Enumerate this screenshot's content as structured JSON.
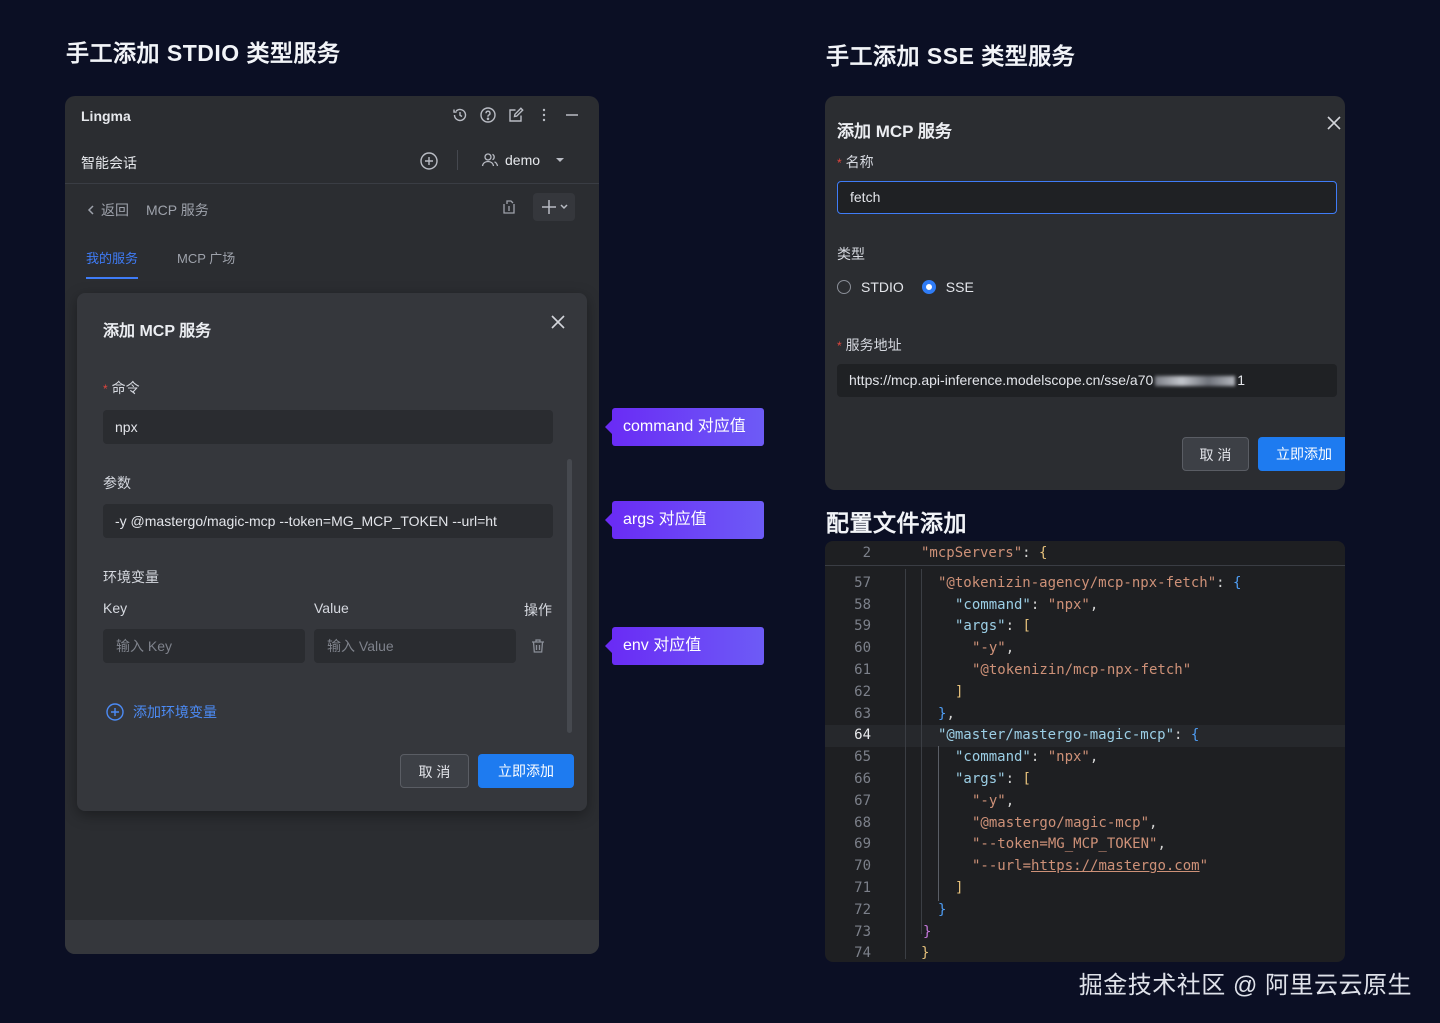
{
  "headings": {
    "stdio": "手工添加 STDIO 类型服务",
    "sse": "手工添加 SSE 类型服务",
    "config": "配置文件添加"
  },
  "left": {
    "app_name": "Lingma",
    "icons": [
      "history-icon",
      "help-icon",
      "edit-icon",
      "more-icon",
      "minimize-icon"
    ],
    "chat_title": "智能会话",
    "user": "demo",
    "back_label": "返回",
    "nav_title": "MCP 服务",
    "tabs": [
      {
        "label": "我的服务",
        "active": true
      },
      {
        "label": "MCP 广场",
        "active": false
      }
    ],
    "dialog": {
      "title": "添加 MCP 服务",
      "command_label": "命令",
      "command_value": "npx",
      "args_label": "参数",
      "args_value": "-y @mastergo/magic-mcp --token=MG_MCP_TOKEN --url=ht",
      "env_label": "环境变量",
      "key_header": "Key",
      "value_header": "Value",
      "action_header": "操作",
      "key_placeholder": "输入 Key",
      "value_placeholder": "输入 Value",
      "add_env": "添加环境变量",
      "cancel": "取 消",
      "submit": "立即添加"
    }
  },
  "callouts": {
    "command": "command 对应值",
    "args": "args 对应值",
    "env": "env 对应值"
  },
  "sse": {
    "title": "添加 MCP 服务",
    "name_label": "名称",
    "name_value": "fetch",
    "type_label": "类型",
    "options": [
      {
        "label": "STDIO",
        "selected": false
      },
      {
        "label": "SSE",
        "selected": true
      }
    ],
    "url_label": "服务地址",
    "url_value_prefix": "https://mcp.api-inference.modelscope.cn/sse/a70",
    "url_value_suffix": "1",
    "cancel": "取 消",
    "submit": "立即添加"
  },
  "code": {
    "lines": [
      {
        "n": "2",
        "indent": 0,
        "tokens": [
          [
            "s",
            "\"mcpServers\""
          ],
          [
            "p",
            ": "
          ],
          [
            "b1",
            "{"
          ]
        ]
      },
      {
        "n": "57",
        "indent": 1,
        "tokens": [
          [
            "s",
            "\"@tokenizin-agency/mcp-npx-fetch\""
          ],
          [
            "p",
            ": "
          ],
          [
            "b3",
            "{"
          ]
        ]
      },
      {
        "n": "58",
        "indent": 2,
        "tokens": [
          [
            "k",
            "\"command\""
          ],
          [
            "p",
            ": "
          ],
          [
            "s",
            "\"npx\""
          ],
          [
            "p",
            ","
          ]
        ]
      },
      {
        "n": "59",
        "indent": 2,
        "tokens": [
          [
            "k",
            "\"args\""
          ],
          [
            "p",
            ": "
          ],
          [
            "b1",
            "["
          ]
        ]
      },
      {
        "n": "60",
        "indent": 3,
        "tokens": [
          [
            "s",
            "\"-y\""
          ],
          [
            "p",
            ","
          ]
        ]
      },
      {
        "n": "61",
        "indent": 3,
        "tokens": [
          [
            "s",
            "\"@tokenizin/mcp-npx-fetch\""
          ]
        ]
      },
      {
        "n": "62",
        "indent": 2,
        "tokens": [
          [
            "b1",
            "]"
          ]
        ]
      },
      {
        "n": "63",
        "indent": 1,
        "tokens": [
          [
            "b3",
            "}"
          ],
          [
            "p",
            ","
          ]
        ]
      },
      {
        "n": "64",
        "indent": 1,
        "current": true,
        "tokens": [
          [
            "k",
            "\"@master/mastergo-magic-mcp\""
          ],
          [
            "p",
            ": "
          ],
          [
            "b3",
            "{"
          ]
        ]
      },
      {
        "n": "65",
        "indent": 2,
        "tokens": [
          [
            "k",
            "\"command\""
          ],
          [
            "p",
            ": "
          ],
          [
            "s",
            "\"npx\""
          ],
          [
            "p",
            ","
          ]
        ]
      },
      {
        "n": "66",
        "indent": 2,
        "tokens": [
          [
            "k",
            "\"args\""
          ],
          [
            "p",
            ": "
          ],
          [
            "b1",
            "["
          ]
        ]
      },
      {
        "n": "67",
        "indent": 3,
        "tokens": [
          [
            "s",
            "\"-y\""
          ],
          [
            "p",
            ","
          ]
        ]
      },
      {
        "n": "68",
        "indent": 3,
        "tokens": [
          [
            "s",
            "\"@mastergo/magic-mcp\""
          ],
          [
            "p",
            ","
          ]
        ]
      },
      {
        "n": "69",
        "indent": 3,
        "tokens": [
          [
            "s",
            "\"--token=MG_MCP_TOKEN\""
          ],
          [
            "p",
            ","
          ]
        ]
      },
      {
        "n": "70",
        "indent": 3,
        "tokens": [
          [
            "s",
            "\"--url="
          ],
          [
            "su",
            "https://mastergo.com"
          ],
          [
            "s",
            "\""
          ]
        ]
      },
      {
        "n": "71",
        "indent": 2,
        "tokens": [
          [
            "b1",
            "]"
          ]
        ]
      },
      {
        "n": "72",
        "indent": 1,
        "tokens": [
          [
            "b3",
            "}"
          ]
        ]
      },
      {
        "n": "73",
        "indent": 0,
        "pad": 1,
        "tokens": [
          [
            "b2",
            "}"
          ]
        ]
      },
      {
        "n": "74",
        "indent": 0,
        "tokens": [
          [
            "b1",
            "}"
          ]
        ]
      }
    ]
  },
  "watermark": "掘金技术社区 @ 阿里云云原生"
}
